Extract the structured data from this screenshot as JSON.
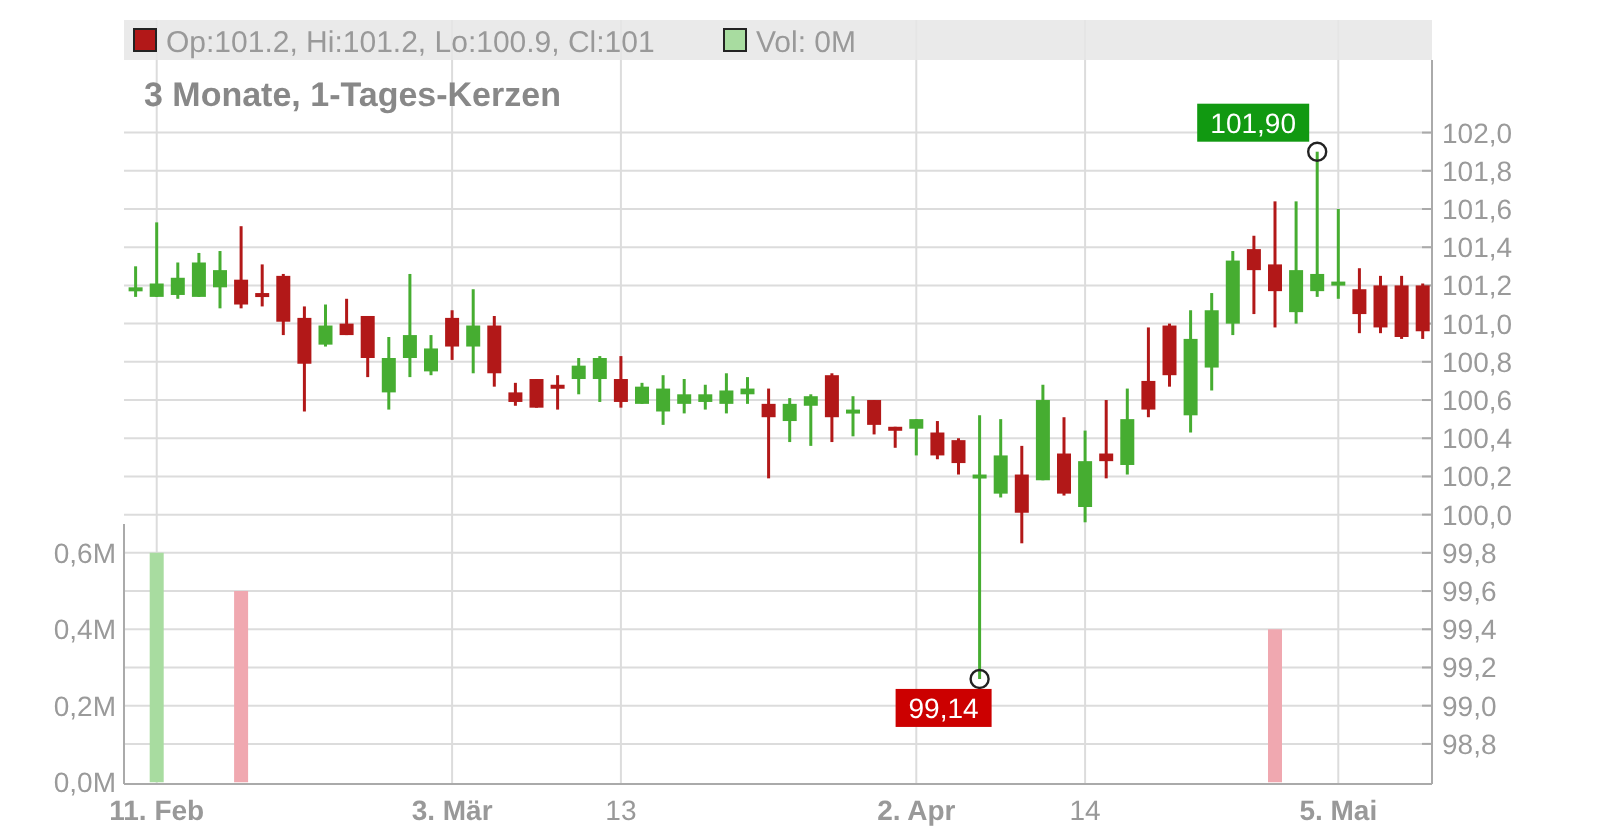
{
  "legend": [
    {
      "label": "Op:101.2, Hi:101.2, Lo:100.9, Cl:101",
      "color": "#b21818"
    },
    {
      "label": "Vol: 0M",
      "color": "#a8dca0"
    }
  ],
  "title": "3 Monate, 1-Tages-Kerzen",
  "price_chart": {
    "xtick_bold": [
      true,
      true,
      false,
      true,
      false,
      true
    ],
    "chart_data": {
      "type": "candlestick",
      "categories": [
        null,
        "11. Feb",
        null,
        null,
        null,
        null,
        null,
        null,
        null,
        null,
        null,
        null,
        null,
        null,
        null,
        "3. Mär",
        null,
        null,
        null,
        null,
        null,
        null,
        null,
        "13",
        null,
        null,
        null,
        null,
        null,
        null,
        null,
        null,
        null,
        null,
        null,
        null,
        null,
        "2. Apr",
        null,
        null,
        null,
        null,
        null,
        null,
        null,
        "14",
        null,
        null,
        null,
        null,
        null,
        null,
        null,
        null,
        null,
        null,
        null,
        "5. Mai",
        null,
        null,
        null,
        null
      ],
      "ohlc": [
        [
          101.18,
          101.3,
          101.14,
          101.19
        ],
        [
          101.14,
          101.53,
          101.14,
          101.21
        ],
        [
          101.15,
          101.32,
          101.13,
          101.24
        ],
        [
          101.14,
          101.37,
          101.14,
          101.32
        ],
        [
          101.19,
          101.38,
          101.08,
          101.28
        ],
        [
          101.23,
          101.51,
          101.08,
          101.1
        ],
        [
          101.16,
          101.31,
          101.09,
          101.15
        ],
        [
          101.25,
          101.26,
          100.94,
          101.01
        ],
        [
          101.03,
          101.09,
          100.54,
          100.79
        ],
        [
          100.89,
          101.1,
          100.88,
          100.99
        ],
        [
          101.0,
          101.13,
          100.94,
          100.94
        ],
        [
          101.04,
          101.04,
          100.72,
          100.82
        ],
        [
          100.64,
          100.93,
          100.55,
          100.82
        ],
        [
          100.82,
          101.26,
          100.72,
          100.94
        ],
        [
          100.75,
          100.94,
          100.73,
          100.87
        ],
        [
          101.03,
          101.07,
          100.81,
          100.88
        ],
        [
          100.88,
          101.18,
          100.74,
          100.99
        ],
        [
          100.99,
          101.04,
          100.67,
          100.74
        ],
        [
          100.64,
          100.69,
          100.57,
          100.59
        ],
        [
          100.71,
          100.71,
          100.56,
          100.56
        ],
        [
          100.68,
          100.73,
          100.55,
          100.67
        ],
        [
          100.71,
          100.82,
          100.63,
          100.78
        ],
        [
          100.71,
          100.83,
          100.59,
          100.82
        ],
        [
          100.71,
          100.83,
          100.56,
          100.59
        ],
        [
          100.58,
          100.69,
          100.58,
          100.67
        ],
        [
          100.54,
          100.73,
          100.47,
          100.66
        ],
        [
          100.58,
          100.71,
          100.53,
          100.63
        ],
        [
          100.59,
          100.68,
          100.55,
          100.63
        ],
        [
          100.58,
          100.74,
          100.53,
          100.65
        ],
        [
          100.63,
          100.72,
          100.58,
          100.66
        ],
        [
          100.58,
          100.66,
          100.19,
          100.51
        ],
        [
          100.49,
          100.61,
          100.38,
          100.58
        ],
        [
          100.57,
          100.63,
          100.36,
          100.62
        ],
        [
          100.73,
          100.74,
          100.38,
          100.51
        ],
        [
          100.53,
          100.62,
          100.41,
          100.55
        ],
        [
          100.6,
          100.6,
          100.42,
          100.47
        ],
        [
          100.46,
          100.46,
          100.35,
          100.44
        ],
        [
          100.45,
          100.5,
          100.31,
          100.5
        ],
        [
          100.43,
          100.49,
          100.29,
          100.31
        ],
        [
          100.39,
          100.4,
          100.21,
          100.27
        ],
        [
          100.2,
          100.52,
          99.14,
          100.21
        ],
        [
          100.11,
          100.5,
          100.09,
          100.31
        ],
        [
          100.21,
          100.36,
          99.85,
          100.01
        ],
        [
          100.18,
          100.68,
          100.18,
          100.6
        ],
        [
          100.32,
          100.51,
          100.1,
          100.11
        ],
        [
          100.04,
          100.44,
          99.96,
          100.28
        ],
        [
          100.32,
          100.6,
          100.19,
          100.28
        ],
        [
          100.26,
          100.66,
          100.21,
          100.5
        ],
        [
          100.7,
          100.98,
          100.51,
          100.55
        ],
        [
          100.99,
          101.0,
          100.67,
          100.73
        ],
        [
          100.52,
          101.07,
          100.43,
          100.92
        ],
        [
          100.77,
          101.16,
          100.65,
          101.07
        ],
        [
          101.0,
          101.38,
          100.94,
          101.33
        ],
        [
          101.39,
          101.46,
          101.05,
          101.28
        ],
        [
          101.31,
          101.64,
          100.98,
          101.17
        ],
        [
          101.06,
          101.64,
          101.0,
          101.28
        ],
        [
          101.17,
          101.9,
          101.14,
          101.26
        ],
        [
          101.21,
          101.6,
          101.13,
          101.22
        ],
        [
          101.18,
          101.29,
          100.95,
          101.05
        ],
        [
          101.2,
          101.25,
          100.95,
          100.98
        ],
        [
          101.2,
          101.25,
          100.92,
          100.93
        ],
        [
          101.2,
          101.21,
          100.92,
          100.96
        ]
      ],
      "ylim": [
        98.59,
        102.38
      ],
      "yticks": [
        {
          "value": 102.0,
          "label": "102,0"
        },
        {
          "value": 101.8,
          "label": "101,8"
        },
        {
          "value": 101.6,
          "label": "101,6"
        },
        {
          "value": 101.4,
          "label": "101,4"
        },
        {
          "value": 101.2,
          "label": "101,2"
        },
        {
          "value": 101.0,
          "label": "101,0"
        },
        {
          "value": 100.8,
          "label": "100,8"
        },
        {
          "value": 100.6,
          "label": "100,6"
        },
        {
          "value": 100.4,
          "label": "100,4"
        },
        {
          "value": 100.2,
          "label": "100,2"
        },
        {
          "value": 100.0,
          "label": "100,0"
        },
        {
          "value": 99.8,
          "label": "99,8"
        },
        {
          "value": 99.6,
          "label": "99,6"
        },
        {
          "value": 99.4,
          "label": "99,4"
        },
        {
          "value": 99.2,
          "label": "99,2"
        },
        {
          "value": 99.0,
          "label": "99,0"
        },
        {
          "value": 98.8,
          "label": "98,8"
        }
      ],
      "grid": true,
      "annotations": [
        "101,90",
        "99,14"
      ]
    }
  },
  "volume_chart": {
    "chart_data": {
      "type": "bar",
      "categories": [
        null,
        null,
        null,
        null,
        null,
        null,
        null,
        null,
        null,
        null,
        null,
        null,
        null,
        null,
        null,
        null,
        null,
        null,
        null,
        null,
        null,
        null,
        null,
        null,
        null,
        null,
        null,
        null,
        null,
        null,
        null,
        null,
        null,
        null,
        null,
        null,
        null,
        null,
        null,
        null,
        null,
        null,
        null,
        null,
        null,
        null,
        null,
        null,
        null,
        null,
        null,
        null,
        null,
        null,
        null,
        null,
        null,
        null,
        null,
        null,
        null,
        null
      ],
      "values": [
        0,
        0.6,
        0,
        0,
        0,
        0.5,
        0,
        0,
        0,
        0,
        0,
        0,
        0,
        0,
        0,
        0,
        0,
        0,
        0,
        0,
        0,
        0,
        0,
        0,
        0,
        0,
        0,
        0,
        0,
        0,
        0,
        0,
        0,
        0,
        0,
        0,
        0,
        0,
        0,
        0,
        0,
        0,
        0,
        0,
        0,
        0,
        0,
        0,
        0,
        0,
        0,
        0,
        0,
        0,
        0.4,
        0,
        0,
        0,
        0,
        0,
        0,
        0
      ],
      "ylim": [
        0,
        0.6
      ],
      "yticks": [
        {
          "value": 0,
          "label": "0,0M"
        },
        {
          "value": 0.2,
          "label": "0,2M"
        },
        {
          "value": 0.4,
          "label": "0,4M"
        },
        {
          "value": 0.6,
          "label": "0,6M"
        }
      ]
    }
  }
}
